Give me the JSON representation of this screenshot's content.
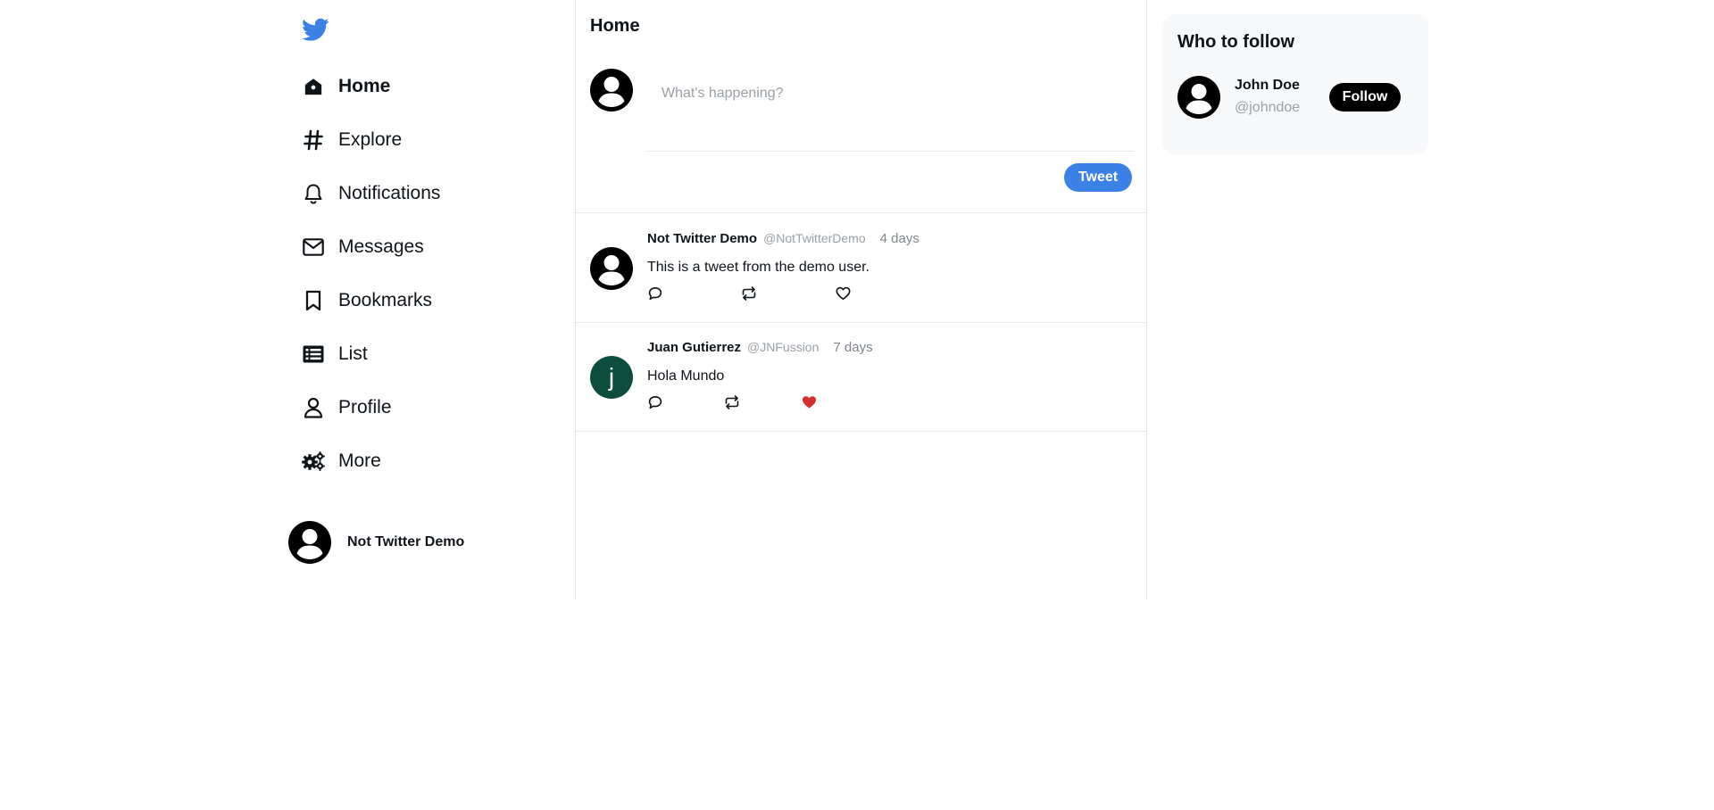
{
  "app": {
    "brand_color": "#3b82e6",
    "logo_icon": "twitter-bird-icon"
  },
  "sidebar": {
    "items": [
      {
        "label": "Home",
        "icon": "home-icon",
        "active": true
      },
      {
        "label": "Explore",
        "icon": "hashtag-icon",
        "active": false
      },
      {
        "label": "Notifications",
        "icon": "bell-icon",
        "active": false
      },
      {
        "label": "Messages",
        "icon": "envelope-icon",
        "active": false
      },
      {
        "label": "Bookmarks",
        "icon": "bookmark-icon",
        "active": false
      },
      {
        "label": "List",
        "icon": "list-icon",
        "active": false
      },
      {
        "label": "Profile",
        "icon": "user-icon",
        "active": false
      },
      {
        "label": "More",
        "icon": "gears-icon",
        "active": false
      }
    ],
    "account": {
      "name": "Not Twitter Demo"
    }
  },
  "main": {
    "title": "Home",
    "compose": {
      "placeholder": "What's happening?",
      "value": "",
      "button_label": "Tweet"
    },
    "tweets": [
      {
        "name": "Not Twitter Demo",
        "handle": "@NotTwitterDemo",
        "time": "4 days",
        "text": "This is a tweet from the demo user.",
        "avatar": "default-user-avatar",
        "liked": false
      },
      {
        "name": "Juan Gutierrez",
        "handle": "@JNFussion",
        "time": "7 days",
        "text": "Hola Mundo",
        "avatar_letter": "j",
        "avatar_color": "#0c4d3e",
        "liked": true,
        "like_color": "#d32f2f"
      }
    ]
  },
  "who_to_follow": {
    "title": "Who to follow",
    "users": [
      {
        "name": "John Doe",
        "handle": "@johndoe",
        "button_label": "Follow"
      }
    ]
  }
}
